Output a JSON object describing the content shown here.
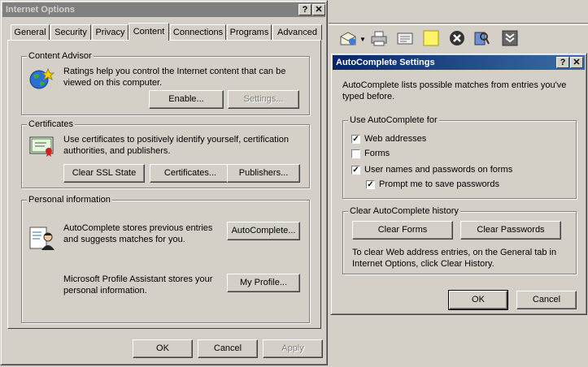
{
  "io": {
    "title": "Internet Options",
    "help": "?",
    "close": "✕",
    "tabs": [
      "General",
      "Security",
      "Privacy",
      "Content",
      "Connections",
      "Programs",
      "Advanced"
    ],
    "content_advisor": {
      "label": "Content Advisor",
      "text": "Ratings help you control the Internet content that can be viewed on this computer.",
      "enable": "Enable...",
      "settings": "Settings..."
    },
    "certificates": {
      "label": "Certificates",
      "text": "Use certificates to positively identify yourself, certification authorities, and publishers.",
      "clear_ssl": "Clear SSL State",
      "certs": "Certificates...",
      "publishers": "Publishers..."
    },
    "personal": {
      "label": "Personal information",
      "autocomplete_text": "AutoComplete stores previous entries and suggests matches for you.",
      "autocomplete_btn": "AutoComplete...",
      "profile_text": "Microsoft Profile Assistant stores your personal information.",
      "profile_btn": "My Profile..."
    },
    "ok": "OK",
    "cancel": "Cancel",
    "apply": "Apply"
  },
  "ac": {
    "title": "AutoComplete Settings",
    "help": "?",
    "close": "✕",
    "intro": "AutoComplete lists possible matches from entries you've typed before.",
    "use_label": "Use AutoComplete for",
    "web": "Web addresses",
    "forms": "Forms",
    "users": "User names and passwords on forms",
    "prompt": "Prompt me to save passwords",
    "checked": {
      "web": true,
      "forms": false,
      "users": true,
      "prompt": true
    },
    "clear_label": "Clear AutoComplete history",
    "clear_forms": "Clear Forms",
    "clear_passwords": "Clear Passwords",
    "clear_note": "To clear Web address entries, on the General tab in Internet Options, click Clear History.",
    "ok": "OK",
    "cancel": "Cancel"
  },
  "colors": {
    "active_title": "#0a246a",
    "inactive_title": "#808080",
    "face": "#d4d0c8"
  },
  "toolbar_icons": [
    "mail-icon",
    "print-icon",
    "edit-icon",
    "note-icon",
    "stop-icon",
    "research-icon",
    "expand-icon"
  ]
}
